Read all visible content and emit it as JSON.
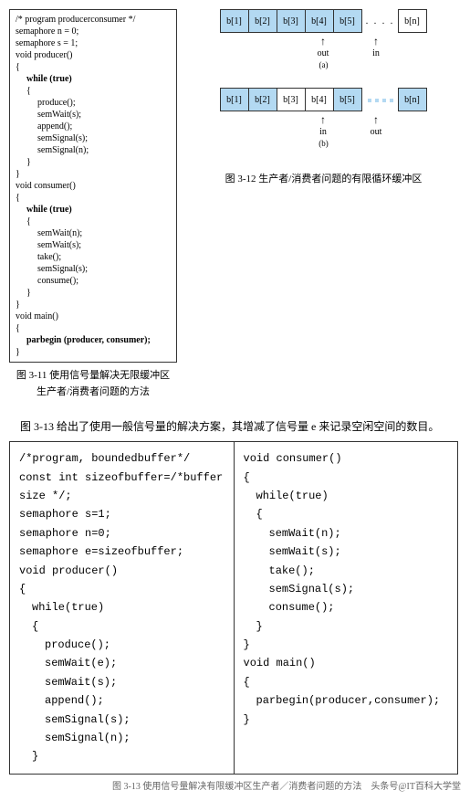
{
  "fig311": {
    "lines": [
      {
        "t": "/* program  producerconsumer */",
        "cls": ""
      },
      {
        "t": "semaphore n = 0;",
        "cls": ""
      },
      {
        "t": "semaphore s = 1;",
        "cls": ""
      },
      {
        "t": "void producer()",
        "cls": ""
      },
      {
        "t": "{",
        "cls": ""
      },
      {
        "t": "while (true)",
        "cls": "indent1 kw"
      },
      {
        "t": "{",
        "cls": "indent1"
      },
      {
        "t": "produce();",
        "cls": "indent2"
      },
      {
        "t": "semWait(s);",
        "cls": "indent2"
      },
      {
        "t": "append();",
        "cls": "indent2"
      },
      {
        "t": "semSignal(s);",
        "cls": "indent2"
      },
      {
        "t": "semSignal(n);",
        "cls": "indent2"
      },
      {
        "t": "}",
        "cls": "indent1"
      },
      {
        "t": "}",
        "cls": ""
      },
      {
        "t": "void consumer()",
        "cls": ""
      },
      {
        "t": "{",
        "cls": ""
      },
      {
        "t": "while (true)",
        "cls": "indent1 kw"
      },
      {
        "t": "{",
        "cls": "indent1"
      },
      {
        "t": "semWait(n);",
        "cls": "indent2"
      },
      {
        "t": "semWait(s);",
        "cls": "indent2"
      },
      {
        "t": "take();",
        "cls": "indent2"
      },
      {
        "t": "semSignal(s);",
        "cls": "indent2"
      },
      {
        "t": "consume();",
        "cls": "indent2"
      },
      {
        "t": "}",
        "cls": "indent1"
      },
      {
        "t": "}",
        "cls": ""
      },
      {
        "t": "void main()",
        "cls": ""
      },
      {
        "t": "{",
        "cls": ""
      },
      {
        "t": "parbegin (producer, consumer);",
        "cls": "indent1 kw"
      },
      {
        "t": "}",
        "cls": ""
      }
    ],
    "caption1": "图 3-11 使用信号量解决无限缓冲区",
    "caption2": "生产者/消费者问题的方法"
  },
  "fig312": {
    "diagA": {
      "cells": [
        "b[1]",
        "b[2]",
        "b[3]",
        "b[4]",
        "b[5]"
      ],
      "shaded": [
        true,
        true,
        true,
        true,
        true
      ],
      "tail": "b[n]",
      "labels": {
        "out": 2,
        "in": 4
      },
      "sub": "(a)"
    },
    "diagB": {
      "cells": [
        "b[1]",
        "b[2]",
        "b[3]",
        "b[4]",
        "b[5]"
      ],
      "shaded": [
        true,
        true,
        false,
        false,
        true
      ],
      "tail": "b[n]",
      "tailShaded": true,
      "dotsShaded": true,
      "labels": {
        "in": 2,
        "out": 4
      },
      "sub": "(b)"
    },
    "caption": "图 3-12 生产者/消费者问题的有限循环缓冲区"
  },
  "intro": "图 3-13 给出了使用一般信号量的解决方案，其增减了信号量 e 来记录空闲空间的数目。",
  "fig313": {
    "left": [
      {
        "t": "/*program, boundedbuffer*/",
        "cls": ""
      },
      {
        "t": "const int sizeofbuffer=/*buffer size */;",
        "cls": ""
      },
      {
        "t": "semaphore s=1;",
        "cls": ""
      },
      {
        "t": "semaphore n=0;",
        "cls": ""
      },
      {
        "t": "semaphore  e=sizeofbuffer;",
        "cls": ""
      },
      {
        "t": "void producer()",
        "cls": ""
      },
      {
        "t": "{",
        "cls": ""
      },
      {
        "t": "while(true)",
        "cls": "i1"
      },
      {
        "t": "{",
        "cls": "i1"
      },
      {
        "t": "produce();",
        "cls": "i2"
      },
      {
        "t": "semWait(e);",
        "cls": "i2"
      },
      {
        "t": "semWait(s);",
        "cls": "i2"
      },
      {
        "t": "append();",
        "cls": "i2"
      },
      {
        "t": "semSignal(s);",
        "cls": "i2"
      },
      {
        "t": "semSignal(n);",
        "cls": "i2"
      },
      {
        "t": "}",
        "cls": "i1"
      }
    ],
    "right": [
      {
        "t": "void consumer()",
        "cls": ""
      },
      {
        "t": "{",
        "cls": ""
      },
      {
        "t": "while(true)",
        "cls": "i1"
      },
      {
        "t": "{",
        "cls": "i1"
      },
      {
        "t": "semWait(n);",
        "cls": "i2"
      },
      {
        "t": "semWait(s);",
        "cls": "i2"
      },
      {
        "t": "take();",
        "cls": "i2"
      },
      {
        "t": "semSignal(s);",
        "cls": "i2"
      },
      {
        "t": "consume();",
        "cls": "i2"
      },
      {
        "t": "}",
        "cls": "i1"
      },
      {
        "t": "}",
        "cls": ""
      },
      {
        "t": "void main()",
        "cls": ""
      },
      {
        "t": "{",
        "cls": ""
      },
      {
        "t": "parbegin(producer,consumer);",
        "cls": "i1"
      },
      {
        "t": "}",
        "cls": ""
      }
    ],
    "caption": "图 3-13 使用信号量解决有限缓冲区生产者／消费者问题的方法"
  },
  "watermark": "头条号@IT百科大学堂"
}
